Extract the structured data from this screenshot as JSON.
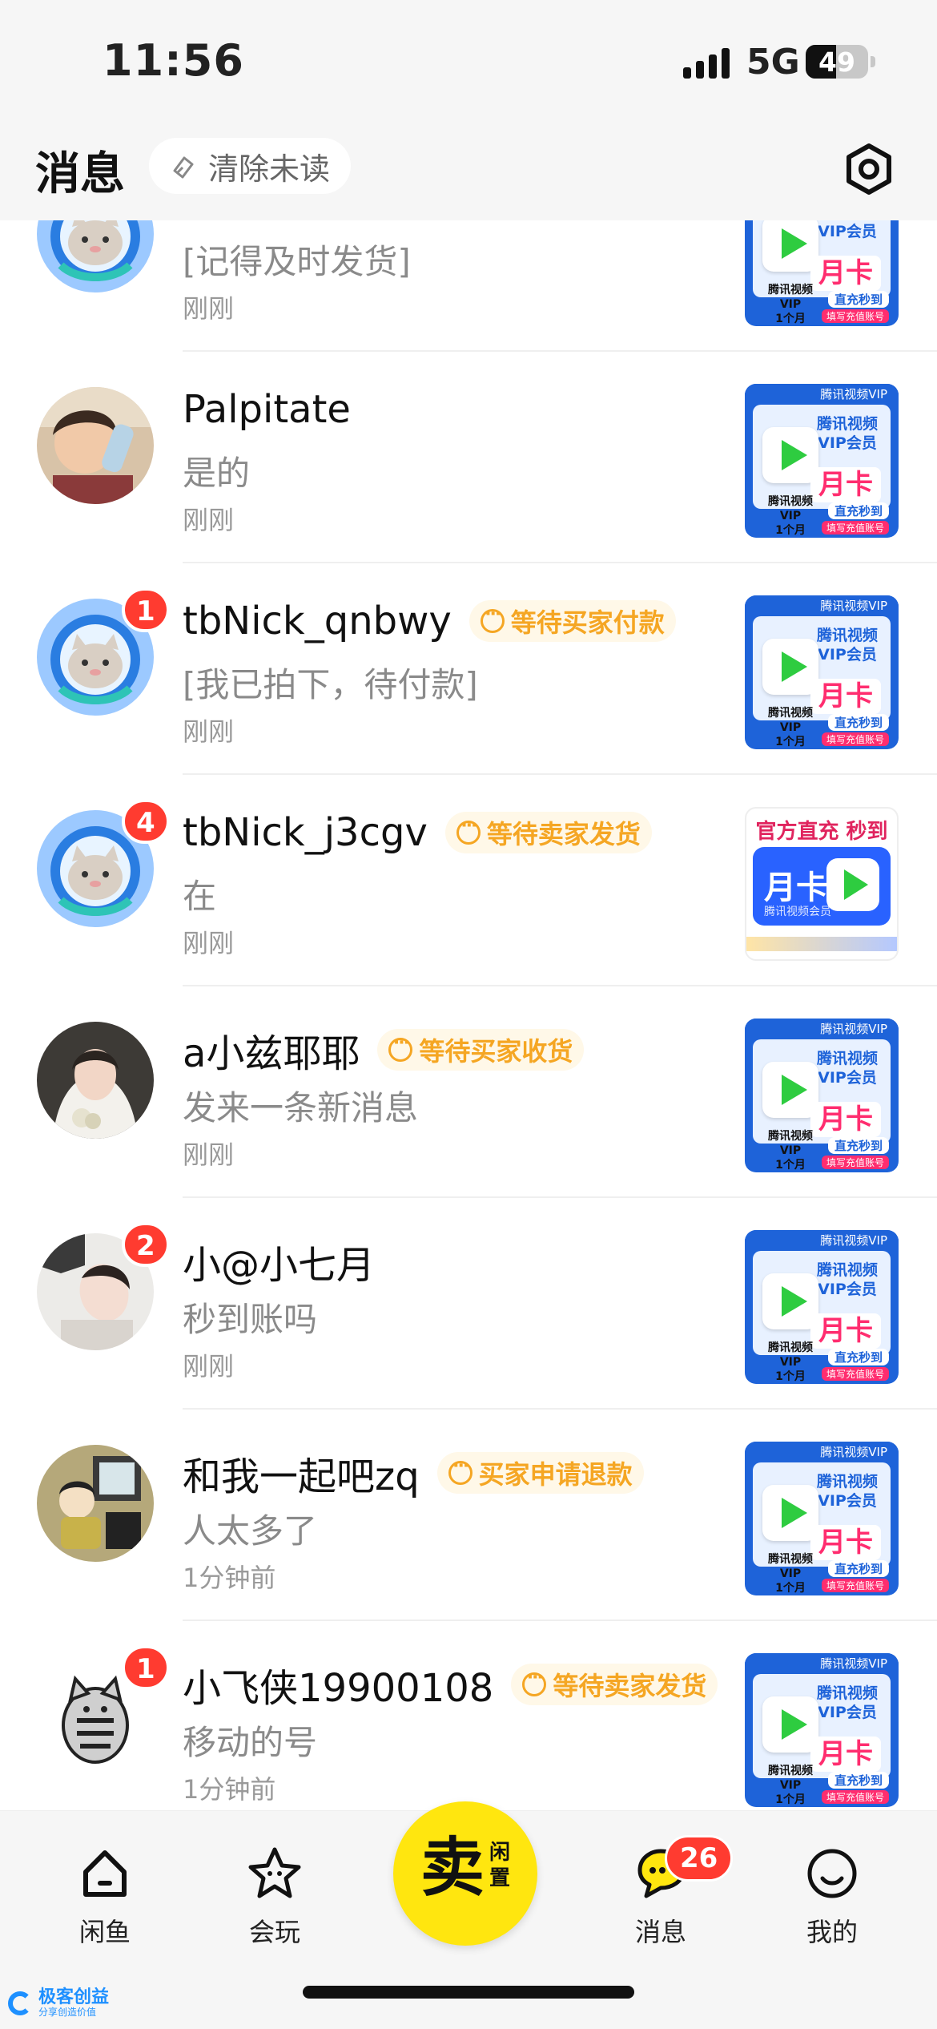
{
  "status": {
    "time": "11:56",
    "network": "5G",
    "battery": "49",
    "battery_level": 0.49
  },
  "header": {
    "title": "消息",
    "clear_label": "清除未读"
  },
  "thumb": {
    "brand_top": "腾讯视频VIP",
    "brand": "腾讯视频\nVIP会员",
    "card": "月卡",
    "sub": "腾讯视频VIP\n1个月",
    "fast": "直充秒到",
    "fill": "填写充值账号",
    "alt_top": "官方直充 秒到",
    "alt_card": "月卡",
    "alt_sub": "腾讯视频会员"
  },
  "conversations": [
    {
      "name": "",
      "tag": "",
      "message": "[记得及时发货]",
      "time": "刚刚",
      "badge": "",
      "avatar": "cat-icon",
      "thumb": "tencent"
    },
    {
      "name": "Palpitate",
      "tag": "",
      "message": "是的",
      "time": "刚刚",
      "badge": "",
      "avatar": "photo-child",
      "thumb": "tencent"
    },
    {
      "name": "tbNick_qnbwy",
      "tag": "等待买家付款",
      "message": "[我已拍下，待付款]",
      "time": "刚刚",
      "badge": "1",
      "avatar": "cat-icon",
      "thumb": "tencent"
    },
    {
      "name": "tbNick_j3cgv",
      "tag": "等待卖家发货",
      "message": "在",
      "time": "刚刚",
      "badge": "4",
      "avatar": "cat-icon",
      "thumb": "alt"
    },
    {
      "name": "a小兹耶耶",
      "tag": "等待买家收货",
      "message": "发来一条新消息",
      "time": "刚刚",
      "badge": "",
      "avatar": "photo-bride",
      "thumb": "tencent"
    },
    {
      "name": "小@小七月",
      "tag": "",
      "message": "秒到账吗",
      "time": "刚刚",
      "badge": "2",
      "avatar": "photo-girl",
      "thumb": "tencent"
    },
    {
      "name": "和我一起吧zq",
      "tag": "买家申请退款",
      "message": "人太多了",
      "time": "1分钟前",
      "badge": "",
      "avatar": "photo-cartoon",
      "thumb": "tencent"
    },
    {
      "name": "小飞侠19900108",
      "tag": "等待卖家发货",
      "message": "移动的号",
      "time": "1分钟前",
      "badge": "1",
      "avatar": "cat-cartoon",
      "thumb": "tencent"
    }
  ],
  "tabs": [
    {
      "label": "闲鱼",
      "icon": "home-icon"
    },
    {
      "label": "会玩",
      "icon": "star-icon"
    },
    {
      "label": "消息",
      "icon": "chat-icon",
      "badge": "26"
    },
    {
      "label": "我的",
      "icon": "smile-icon"
    }
  ],
  "sell": {
    "big": "卖",
    "small": "闲置"
  },
  "watermark": {
    "title": "极客创益",
    "sub": "分享创造价值"
  },
  "colors": {
    "accent": "#ffe60f",
    "tag": "#f5a623",
    "badge": "#ff3b30",
    "brand_blue": "#1e63d9"
  }
}
